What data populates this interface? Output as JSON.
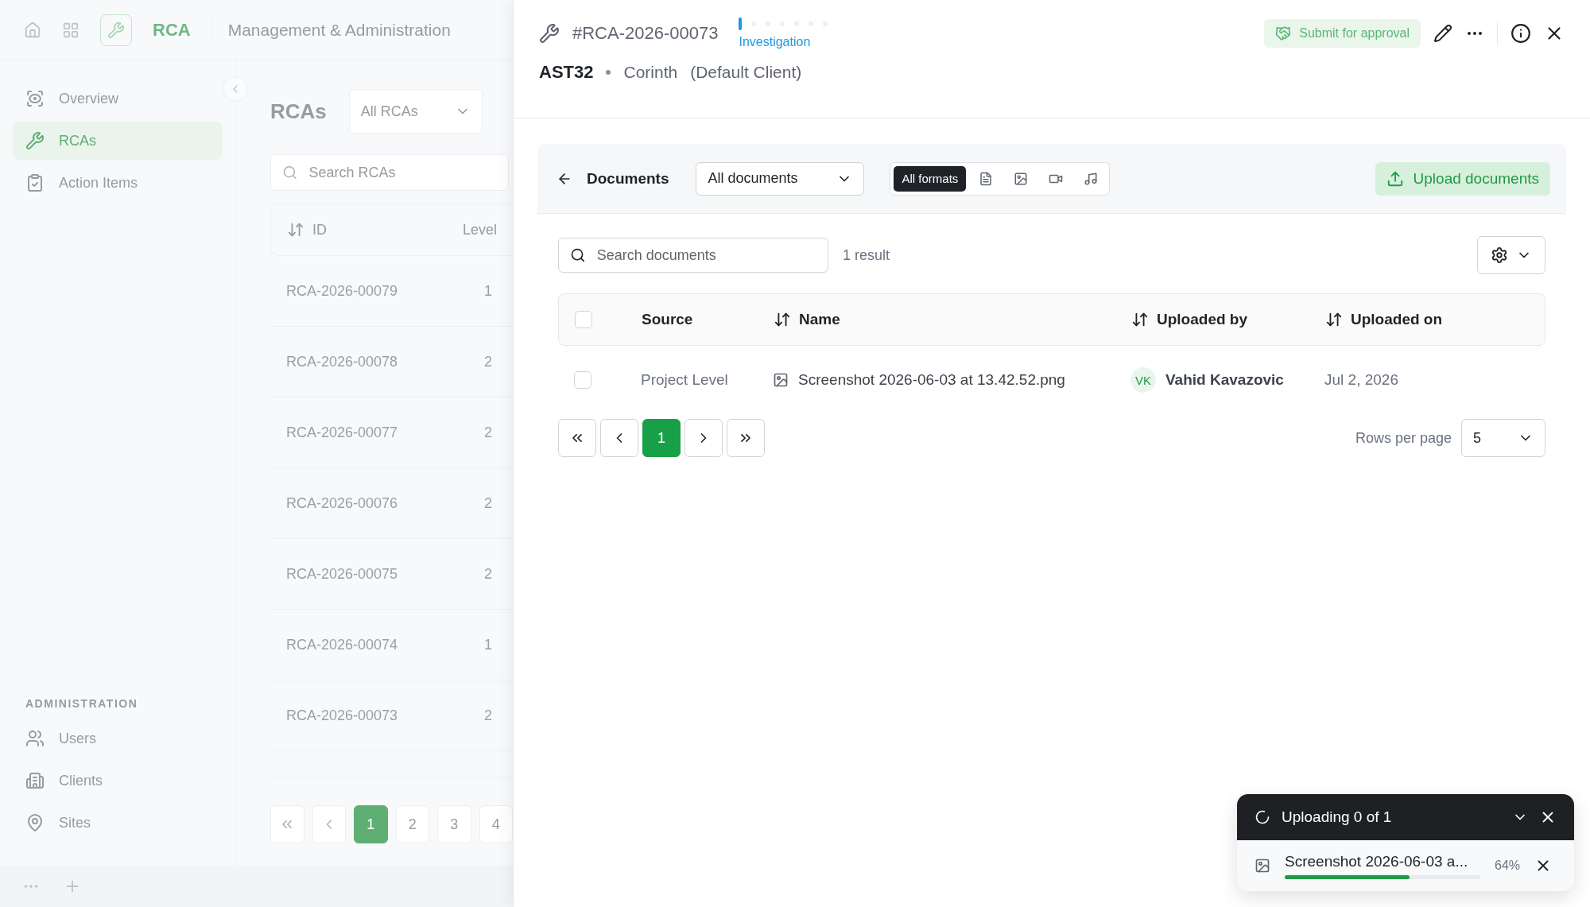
{
  "app_bar": {
    "app_name": "RCA",
    "section": "Management & Administration"
  },
  "sidebar": {
    "items": [
      {
        "label": "Overview",
        "selected": false
      },
      {
        "label": "RCAs",
        "selected": true
      },
      {
        "label": "Action Items",
        "selected": false
      }
    ],
    "admin_heading": "ADMINISTRATION",
    "admin_items": [
      {
        "label": "Users",
        "selected": false
      },
      {
        "label": "Clients",
        "selected": false
      },
      {
        "label": "Sites",
        "selected": false
      }
    ]
  },
  "rca_list": {
    "title": "RCAs",
    "filter": "All RCAs",
    "search": {
      "placeholder": "Search RCAs"
    },
    "columns": [
      "ID",
      "Level"
    ],
    "rows": [
      {
        "id": "RCA-2026-00079",
        "level": "1"
      },
      {
        "id": "RCA-2026-00078",
        "level": "2"
      },
      {
        "id": "RCA-2026-00077",
        "level": "2"
      },
      {
        "id": "RCA-2026-00076",
        "level": "2"
      },
      {
        "id": "RCA-2026-00075",
        "level": "2"
      },
      {
        "id": "RCA-2026-00074",
        "level": "1"
      },
      {
        "id": "RCA-2026-00073",
        "level": "2"
      }
    ],
    "pages": [
      {
        "label": "1",
        "selected": true
      },
      {
        "label": "2",
        "selected": false
      },
      {
        "label": "3",
        "selected": false
      },
      {
        "label": "4",
        "selected": false
      }
    ]
  },
  "panel": {
    "record_id": "#RCA-2026-00073",
    "stage": {
      "label": "Investigation",
      "steps": [
        {
          "selected": true
        },
        {
          "selected": false
        },
        {
          "selected": false
        },
        {
          "selected": false
        },
        {
          "selected": false
        },
        {
          "selected": false
        },
        {
          "selected": false
        }
      ]
    },
    "submit_button": "Submit for approval",
    "asset": "AST32",
    "site": "Corinth",
    "client": "(Default Client)",
    "documents": {
      "title": "Documents",
      "filter": "All documents",
      "formats": [
        {
          "kind": "all",
          "label": "All formats",
          "selected": true
        },
        {
          "kind": "document",
          "selected": false
        },
        {
          "kind": "image",
          "selected": false
        },
        {
          "kind": "video",
          "selected": false
        },
        {
          "kind": "audio",
          "selected": false
        }
      ],
      "upload_button": "Upload documents",
      "search": {
        "placeholder": "Search documents"
      },
      "result_count": "1 result",
      "all_checked": false,
      "columns": [
        {
          "label": "Source",
          "sortable": false
        },
        {
          "label": "Name",
          "sortable": true
        },
        {
          "label": "Uploaded by",
          "sortable": true
        },
        {
          "label": "Uploaded on",
          "sortable": true
        }
      ],
      "rows": [
        {
          "checked": false,
          "source": "Project Level",
          "name": "Screenshot 2026-06-03 at 13.42.52.png",
          "initials": "VK",
          "uploader": "Vahid Kavazovic",
          "date": "Jul 2, 2026"
        }
      ],
      "pages": [
        {
          "label": "1",
          "selected": true
        }
      ],
      "rows_per_page_label": "Rows per page",
      "rows_per_page": "5"
    }
  },
  "upload_toast": {
    "title": "Uploading 0 of 1",
    "files": [
      {
        "name": "Screenshot 2026-06-03 a...",
        "percent": "64%",
        "level": 0.64
      }
    ]
  }
}
